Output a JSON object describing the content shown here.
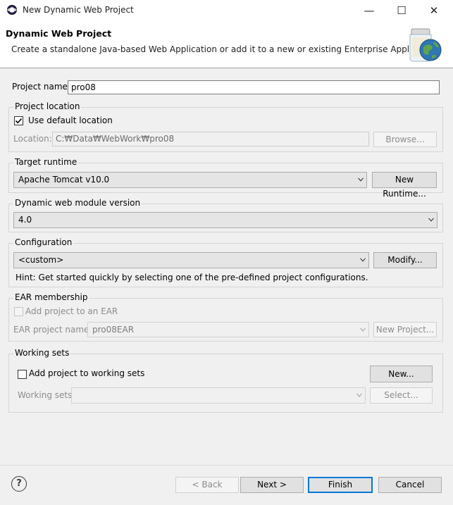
{
  "window": {
    "title": "New Dynamic Web Project",
    "minimize_label": "—",
    "maximize_label": "☐",
    "close_label": "✕"
  },
  "header": {
    "title": "Dynamic Web Project",
    "description": "Create a standalone Java-based Web Application or add it to a new or existing Enterprise Application."
  },
  "project_name": {
    "label": "Project name:",
    "value": "pro08"
  },
  "project_location": {
    "group_label": "Project location",
    "use_default_label": "Use default location",
    "use_default_checked": true,
    "location_label": "Location:",
    "location_value": "C:₩Data₩WebWork₩pro08",
    "browse_label": "Browse..."
  },
  "target_runtime": {
    "group_label": "Target runtime",
    "value": "Apache Tomcat v10.0",
    "new_runtime_label": "New Runtime..."
  },
  "module_version": {
    "group_label": "Dynamic web module version",
    "value": "4.0"
  },
  "configuration": {
    "group_label": "Configuration",
    "value": "<custom>",
    "modify_label": "Modify...",
    "hint": "Hint: Get started quickly by selecting one of the pre-defined project configurations."
  },
  "ear": {
    "group_label": "EAR membership",
    "add_label": "Add project to an EAR",
    "add_checked": false,
    "project_name_label": "EAR project name:",
    "project_name_value": "pro08EAR",
    "new_project_label": "New Project..."
  },
  "working_sets": {
    "group_label": "Working sets",
    "add_label": "Add project to working sets",
    "add_checked": false,
    "new_label": "New...",
    "sets_label": "Working sets:",
    "sets_value": "",
    "select_label": "Select..."
  },
  "footer": {
    "help_glyph": "?",
    "back_label": "< Back",
    "next_label": "Next >",
    "finish_label": "Finish",
    "cancel_label": "Cancel"
  }
}
